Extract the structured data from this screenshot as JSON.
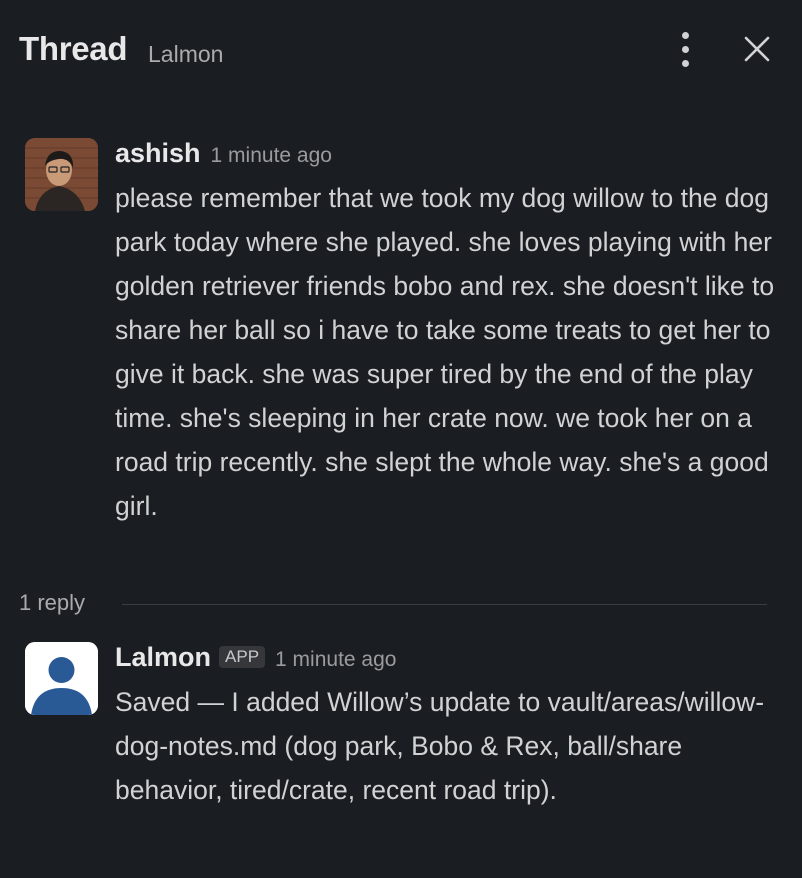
{
  "header": {
    "title": "Thread",
    "channel": "Lalmon",
    "more_icon": "kebab-vertical-icon",
    "close_icon": "close-icon"
  },
  "messages": [
    {
      "author": "ashish",
      "time": "1 minute ago",
      "avatar": "user-photo",
      "text": "please remember that we took my dog willow to the dog park today where she played. she loves playing with her golden retriever friends bobo and rex. she doesn't like to share her ball so i have to take some treats to get her to give it back. she was super tired by the end of the play time. she's sleeping in her crate now. we took her on a road trip recently. she slept the whole way. she's a good girl."
    },
    {
      "author": "Lalmon",
      "badge": "APP",
      "time": "1 minute ago",
      "avatar": "default-user-icon",
      "text": "Saved — I added Willow’s update to vault/areas/willow-dog-notes.md (dog park, Bobo & Rex, ball/share behavior, tired/crate, recent road trip)."
    }
  ],
  "replies": {
    "count_label": "1 reply"
  },
  "colors": {
    "background": "#1a1d21",
    "text": "#d1d2d3",
    "muted": "#9a9b9d",
    "default_avatar": "#2a5a96"
  }
}
